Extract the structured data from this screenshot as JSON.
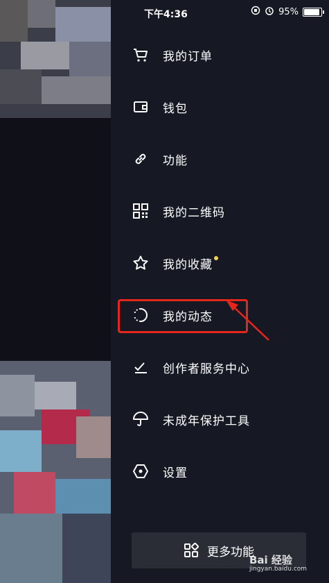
{
  "status_bar": {
    "time": "下午4:36",
    "battery": "95%"
  },
  "menu": [
    {
      "label": "我的订单",
      "icon": "cart-icon"
    },
    {
      "label": "钱包",
      "icon": "wallet-icon"
    },
    {
      "label": "功能",
      "icon": "link-icon"
    },
    {
      "label": "我的二维码",
      "icon": "qr-code-icon"
    },
    {
      "label": "我的收藏",
      "icon": "star-icon",
      "badge": true
    },
    {
      "label": "我的动态",
      "icon": "activity-icon"
    },
    {
      "label": "创作者服务中心",
      "icon": "creator-icon"
    },
    {
      "label": "未成年保护工具",
      "icon": "umbrella-icon"
    },
    {
      "label": "设置",
      "icon": "settings-icon"
    }
  ],
  "more_button": {
    "label": "更多功能"
  },
  "watermark": {
    "brand": "Bai 经验",
    "url": "jingyan.baidu.com"
  },
  "colors": {
    "drawer_bg": "#161823",
    "highlight": "#e5261b",
    "badge": "#f8d348"
  }
}
